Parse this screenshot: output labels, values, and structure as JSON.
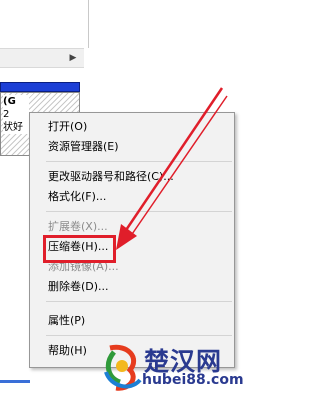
{
  "partition": {
    "label_line1": "(G",
    "label_line2": "2",
    "label_line3": "",
    "label_line4": "状好"
  },
  "context_menu": {
    "items": [
      {
        "label": "打开(O)",
        "disabled": false
      },
      {
        "label": "资源管理器(E)",
        "disabled": false
      },
      {
        "label": "更改驱动器号和路径(C)...",
        "disabled": false
      },
      {
        "label": "格式化(F)...",
        "disabled": false
      },
      {
        "label": "扩展卷(X)...",
        "disabled": true
      },
      {
        "label": "压缩卷(H)...",
        "disabled": false
      },
      {
        "label": "添加镜像(A)...",
        "disabled": true
      },
      {
        "label": "删除卷(D)...",
        "disabled": false
      },
      {
        "label": "属性(P)",
        "disabled": false
      },
      {
        "label": "帮助(H)",
        "disabled": false
      }
    ]
  },
  "highlighted_item": "压缩卷(H)...",
  "watermark": {
    "title": "楚汉网",
    "url": "hubei88.com"
  },
  "colors": {
    "annotation_red": "#e01e2a",
    "disk_bar_blue": "#1c3fd6",
    "watermark_blue": "#2a3a90"
  },
  "icons": {
    "scroll_right": "chevron-right-icon",
    "watermark_logo": "colorful-swirl-logo"
  }
}
